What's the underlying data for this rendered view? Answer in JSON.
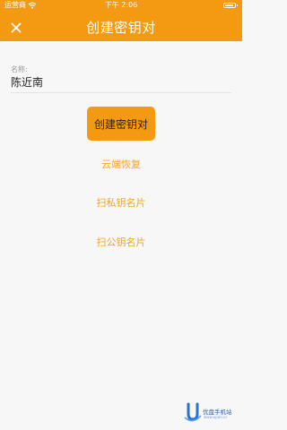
{
  "status_bar": {
    "carrier": "运营商",
    "time": "下午 2:06"
  },
  "nav": {
    "title": "创建密钥对",
    "close_icon": "close-icon"
  },
  "form": {
    "name_label": "名称:",
    "name_value": "陈近南"
  },
  "actions": {
    "create_label": "创建密钥对",
    "cloud_restore_label": "云端恢复",
    "scan_private_label": "扫私钥名片",
    "scan_public_label": "扫公钥名片"
  },
  "watermark": {
    "name": "优盘手机站",
    "url": "www.upan.cc"
  },
  "colors": {
    "accent": "#f39a12",
    "link": "#f3a51d"
  }
}
